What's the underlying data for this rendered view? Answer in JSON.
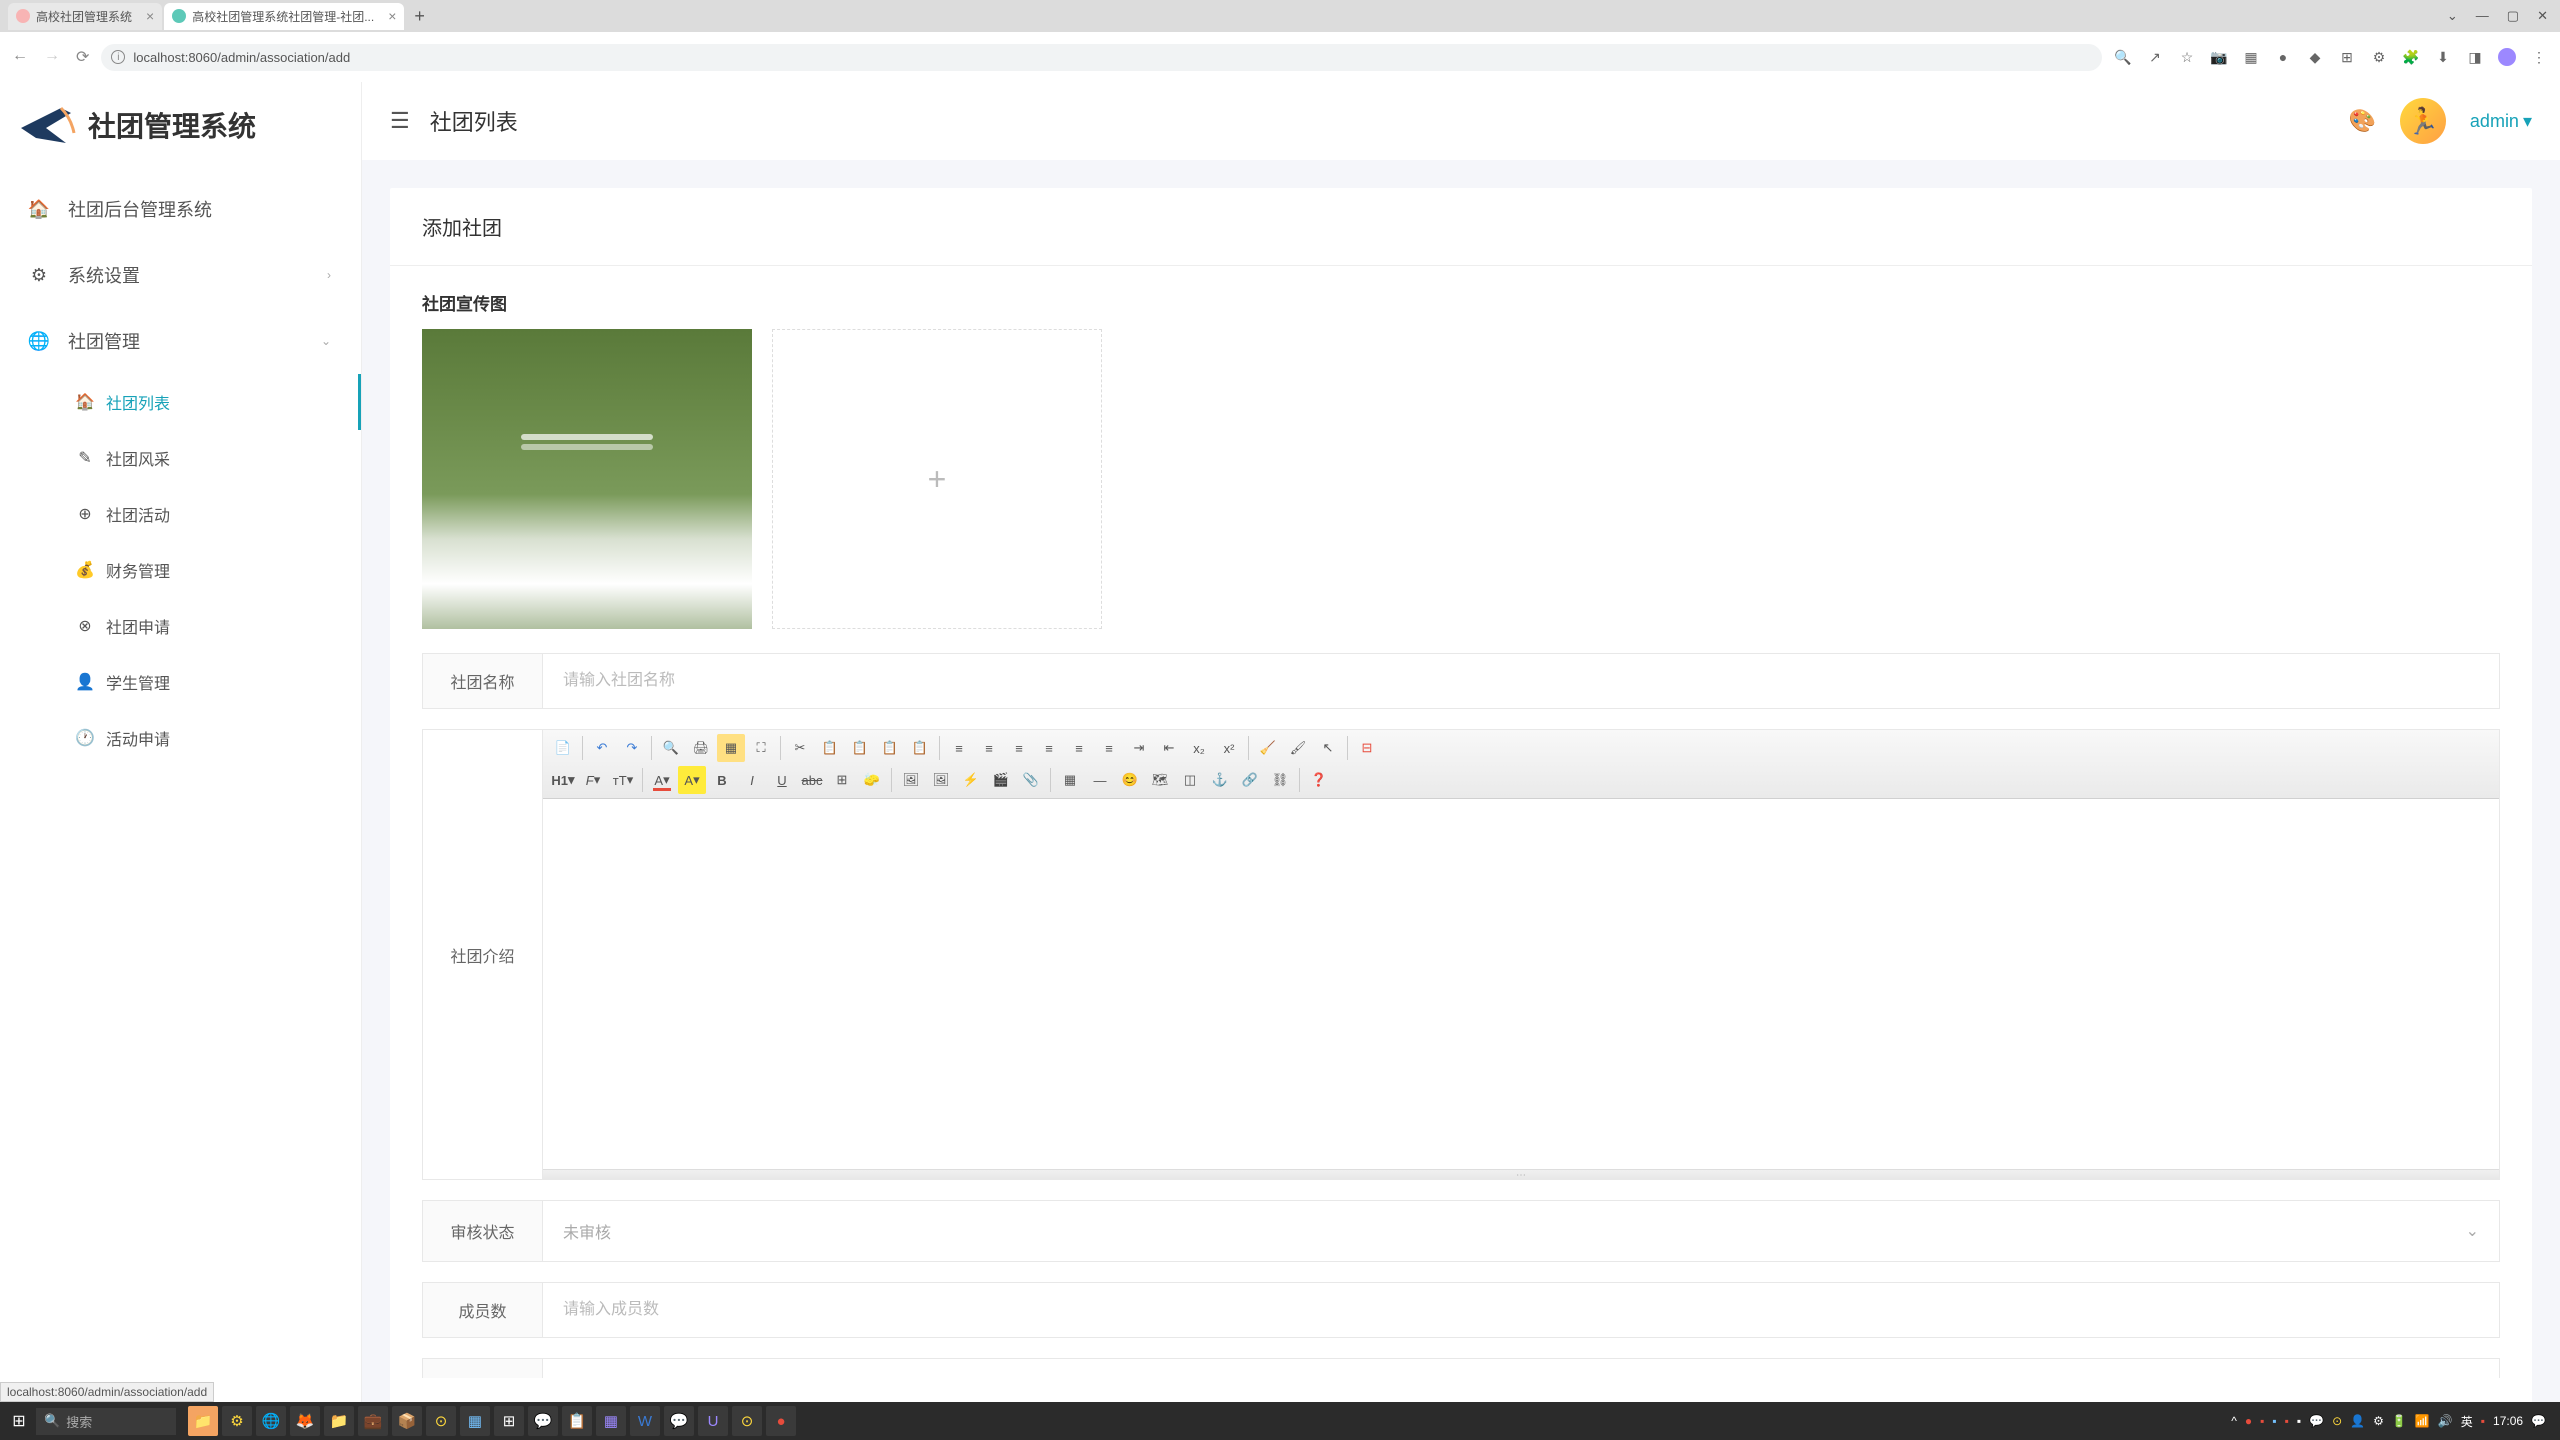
{
  "browser": {
    "tabs": [
      {
        "title": "高校社团管理系统"
      },
      {
        "title": "高校社团管理系统社团管理-社团..."
      }
    ],
    "url": "localhost:8060/admin/association/add",
    "hover_url": "localhost:8060/admin/association/add"
  },
  "logo_text": "社团管理系统",
  "nav": {
    "home": "社团后台管理系统",
    "settings": "系统设置",
    "club_manage": "社团管理",
    "subs": {
      "club_list": "社团列表",
      "club_style": "社团风采",
      "club_activity": "社团活动",
      "finance": "财务管理",
      "club_apply": "社团申请",
      "student": "学生管理",
      "activity_apply": "活动申请"
    }
  },
  "topbar": {
    "title": "社团列表",
    "user": "admin"
  },
  "card": {
    "header": "添加社团",
    "image_section": "社团宣传图",
    "fields": {
      "name_label": "社团名称",
      "name_placeholder": "请输入社团名称",
      "intro_label": "社团介绍",
      "status_label": "审核状态",
      "status_value": "未审核",
      "members_label": "成员数",
      "members_placeholder": "请输入成员数"
    }
  },
  "editor_buttons": {
    "h1": "H1",
    "font": "F",
    "size": "тT",
    "fontcolor": "A",
    "bgcolor": "A",
    "bold": "B",
    "italic": "I",
    "underline": "U",
    "strike": "abc"
  },
  "taskbar": {
    "search_placeholder": "搜索",
    "ime": "英",
    "time": "17:06"
  }
}
